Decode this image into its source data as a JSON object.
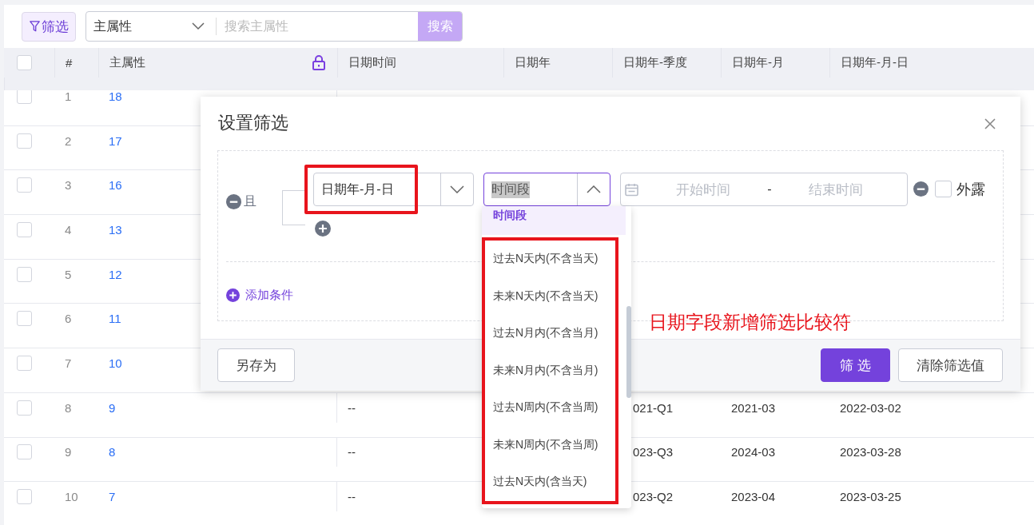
{
  "toolbar": {
    "filter_button": "筛选",
    "field_select": "主属性",
    "search": {
      "placeholder": "搜索主属性"
    },
    "search_button": "搜索"
  },
  "table": {
    "select_all": {
      "checked": false
    },
    "columns": [
      "#",
      "主属性",
      "日期时间",
      "日期年",
      "日期年-季度",
      "日期年-月",
      "日期年-月-日"
    ],
    "rows": [
      {
        "checked": false,
        "index": "1",
        "main": "18"
      },
      {
        "checked": false,
        "index": "2",
        "main": "17"
      },
      {
        "checked": false,
        "index": "3",
        "main": "16"
      },
      {
        "checked": false,
        "index": "4",
        "main": "13"
      },
      {
        "checked": false,
        "index": "5",
        "main": "12"
      },
      {
        "checked": false,
        "index": "6",
        "main": "11"
      },
      {
        "checked": false,
        "index": "7",
        "main": "10"
      },
      {
        "checked": false,
        "index": "8",
        "main": "9",
        "datetime": "--",
        "quarter": "021-Q1",
        "month": "2021-03",
        "day": "2022-03-02"
      },
      {
        "checked": false,
        "index": "9",
        "main": "8",
        "datetime": "--",
        "quarter": "023-Q3",
        "month": "2024-03",
        "day": "2023-03-28"
      },
      {
        "checked": false,
        "index": "10",
        "main": "7",
        "datetime": "--",
        "quarter": "023-Q2",
        "month": "2023-04",
        "day": "2023-03-25"
      }
    ]
  },
  "dialog": {
    "title": "设置筛选",
    "condition": {
      "logic": "且",
      "field": "日期年-月-日",
      "operator": {
        "value": "时间段",
        "expanded": true
      },
      "range": {
        "start_placeholder": "开始时间",
        "separator": "-",
        "end_placeholder": "结束时间"
      },
      "expose": {
        "label": "外露",
        "checked": false
      }
    },
    "add_condition": "添加条件",
    "buttons": [
      {
        "label": "另存为",
        "kind": "default"
      },
      {
        "label": "筛 选",
        "kind": "primary"
      },
      {
        "label": "清除筛选值",
        "kind": "default"
      }
    ]
  },
  "operator_options": [
    {
      "label": "时间段",
      "selected": true
    },
    {
      "label": "过去N天内(不含当天)",
      "selected": false
    },
    {
      "label": "未来N天内(不含当天)",
      "selected": false
    },
    {
      "label": "过去N月内(不含当月)",
      "selected": false
    },
    {
      "label": "未来N月内(不含当月)",
      "selected": false
    },
    {
      "label": "过去N周内(不含当周)",
      "selected": false
    },
    {
      "label": "未来N周内(不含当周)",
      "selected": false
    },
    {
      "label": "过去N天内(含当天)",
      "selected": false
    }
  ],
  "annotation": {
    "text": "日期字段新增筛选比较符"
  }
}
